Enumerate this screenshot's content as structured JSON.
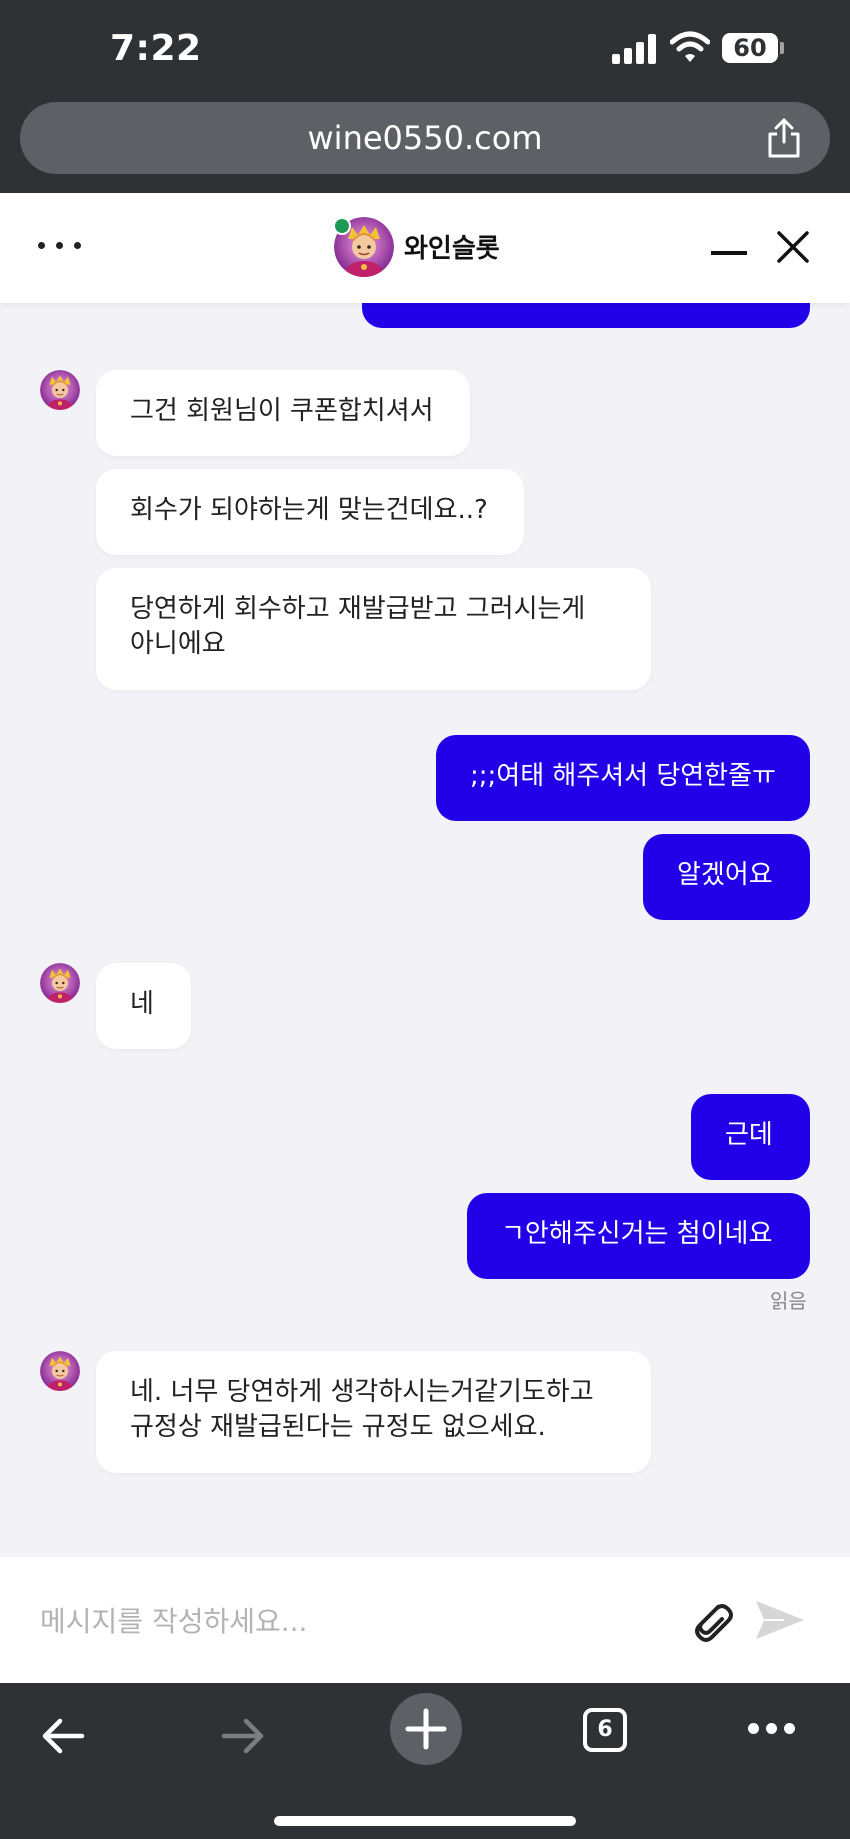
{
  "status_bar": {
    "time": "7:22",
    "battery": "60"
  },
  "browser": {
    "url": "wine0550.com",
    "tab_count": "6"
  },
  "chat_header": {
    "title": "와인슬롯"
  },
  "messages": [
    {
      "lines": [
        "그건 회원님이 쿠폰합치셔서"
      ]
    },
    {
      "lines": [
        "회수가 되야하는게 맞는건데요..?"
      ]
    },
    {
      "lines": [
        "당연하게 회수하고 재발급받고 그러시는게",
        "아니에요"
      ]
    },
    {
      "lines": [
        ";;;여태 해주셔서 당연한줄ㅠ"
      ]
    },
    {
      "lines": [
        "알겠어요"
      ]
    },
    {
      "lines": [
        "네"
      ]
    },
    {
      "lines": [
        "근데"
      ]
    },
    {
      "lines": [
        "ㄱ안해주신거는 첨이네요"
      ]
    },
    {
      "lines": [
        "네. 너무 당연하게 생각하시는거같기도하고",
        "규정상 재발급된다는 규정도 없으세요."
      ]
    }
  ],
  "read_receipt": "읽음",
  "composer": {
    "placeholder": "메시지를 작성하세요..."
  },
  "colors": {
    "outgoing_bubble": "#2200e8",
    "incoming_bubble": "#ffffff",
    "chat_background": "#f3f3f7",
    "browser_chrome": "#2f3235",
    "online_dot": "#1f9a55"
  },
  "icons": [
    "share-icon",
    "menu-dots-icon",
    "minimize-icon",
    "close-icon",
    "paperclip-icon",
    "send-icon",
    "back-arrow-icon",
    "forward-arrow-icon",
    "plus-icon",
    "more-dots-icon"
  ]
}
